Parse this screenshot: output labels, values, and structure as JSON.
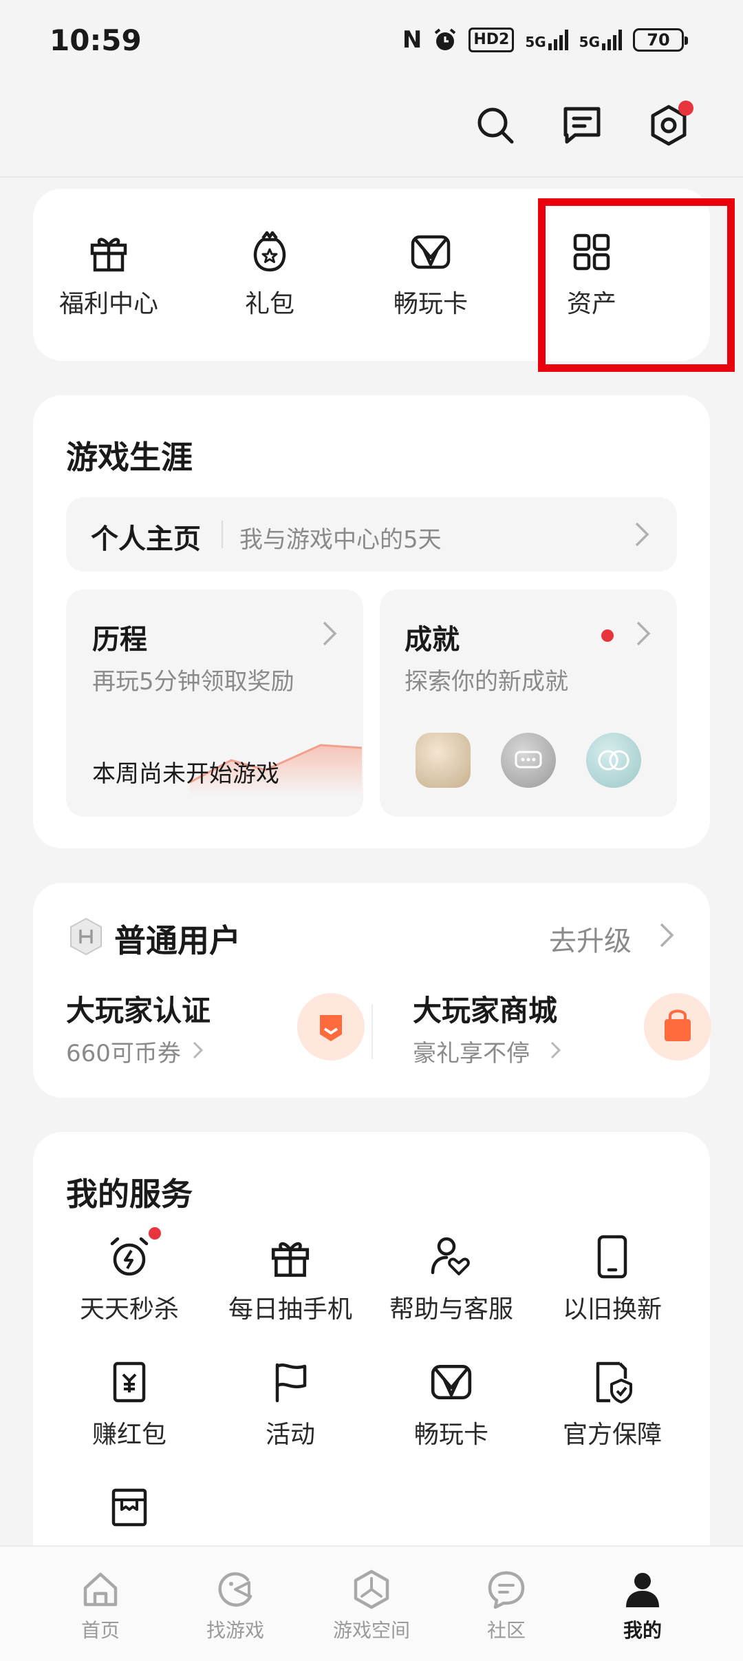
{
  "status_bar": {
    "time": "10:59",
    "nfc": "N",
    "hd_label": "HD2",
    "sim1_label": "5G",
    "sim2_label": "5G",
    "battery": "70"
  },
  "top_actions": {
    "icons": [
      "search-icon",
      "message-icon",
      "settings-icon"
    ],
    "settings_has_dot": true
  },
  "quick_access": {
    "items": [
      {
        "label": "福利中心",
        "icon": "gift-icon"
      },
      {
        "label": "礼包",
        "icon": "gift-bag-icon"
      },
      {
        "label": "畅玩卡",
        "icon": "play-card-icon"
      },
      {
        "label": "资产",
        "icon": "grid-icon"
      }
    ],
    "highlighted_index": 3,
    "highlight_color": "#e8000c"
  },
  "career": {
    "title": "游戏生涯",
    "profile": {
      "label": "个人主页",
      "desc": "我与游戏中心的5天"
    },
    "history": {
      "title": "历程",
      "desc": "再玩5分钟领取奖励",
      "status": "本周尚未开始游戏"
    },
    "achievement": {
      "title": "成就",
      "desc": "探索你的新成就",
      "has_dot": true
    }
  },
  "membership": {
    "level": "普通用户",
    "upgrade": "去升级",
    "cert": {
      "title": "大玩家认证",
      "desc": "660可币券"
    },
    "mall": {
      "title": "大玩家商城",
      "desc": "豪礼享不停"
    },
    "accent": "#ff6b3d"
  },
  "services": {
    "title": "我的服务",
    "items": [
      {
        "label": "天天秒杀",
        "icon": "flash-clock-icon",
        "dot": true
      },
      {
        "label": "每日抽手机",
        "icon": "gift-icon"
      },
      {
        "label": "帮助与客服",
        "icon": "support-icon"
      },
      {
        "label": "以旧换新",
        "icon": "phone-icon"
      },
      {
        "label": "赚红包",
        "icon": "red-packet-icon"
      },
      {
        "label": "活动",
        "icon": "flag-icon"
      },
      {
        "label": "畅玩卡",
        "icon": "play-card-icon"
      },
      {
        "label": "官方保障",
        "icon": "shield-doc-icon"
      },
      {
        "label": "",
        "icon": "store-icon"
      }
    ]
  },
  "bottom_nav": {
    "items": [
      {
        "label": "首页",
        "icon": "home-icon"
      },
      {
        "label": "找游戏",
        "icon": "find-game-icon"
      },
      {
        "label": "游戏空间",
        "icon": "game-space-icon"
      },
      {
        "label": "社区",
        "icon": "community-icon"
      },
      {
        "label": "我的",
        "icon": "profile-icon"
      }
    ],
    "active_index": 4
  }
}
